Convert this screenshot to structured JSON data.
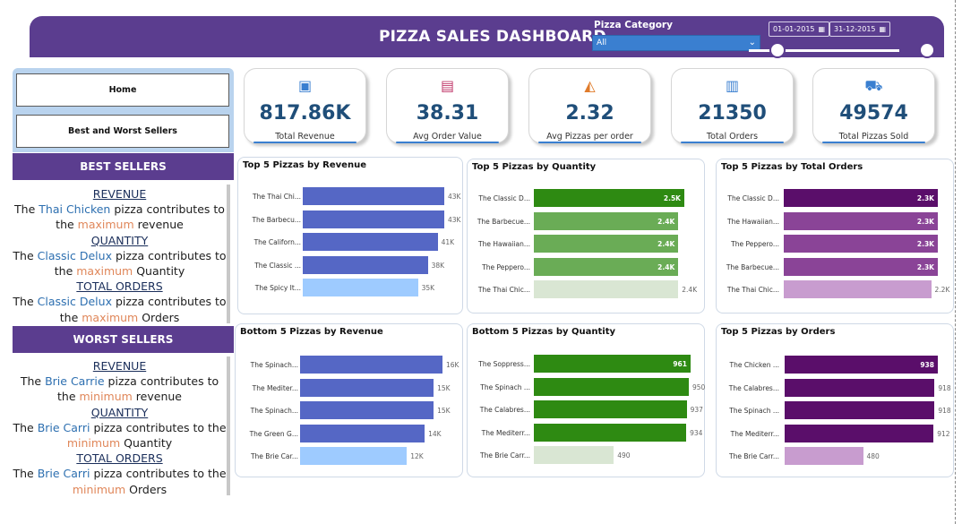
{
  "header": {
    "title": "PIZZA SALES DASHBOARD",
    "category_label": "Pizza Category",
    "category_value": "All",
    "date_start": "01-01-2015",
    "date_end": "31-12-2015"
  },
  "nav": {
    "home": "Home",
    "best_worst": "Best and Worst Sellers"
  },
  "best": {
    "title": "BEST SELLERS",
    "revenue_h": "REVENUE",
    "r_pre": "The ",
    "r_name": "Thai Chicken",
    "r_mid": " pizza contributes to the ",
    "r_word": "maximum",
    "r_post": " revenue",
    "quantity_h": "QUANTITY",
    "q_pre": "The ",
    "q_name": "Classic Delux",
    "q_mid": " pizza contributes to the ",
    "q_word": "maximum",
    "q_post": " Quantity",
    "orders_h": "TOTAL ORDERS",
    "o_pre": "The ",
    "o_name": "Classic Delux",
    "o_mid": " pizza contributes to the ",
    "o_word": "maximum",
    "o_post": " Orders"
  },
  "worst": {
    "title": "WORST SELLERS",
    "revenue_h": "REVENUE",
    "r_pre": "The ",
    "r_name": "Brie Carrie",
    "r_mid": " pizza contributes to the ",
    "r_word": "minimum",
    "r_post": " revenue",
    "quantity_h": "QUANTITY",
    "q_pre": "The ",
    "q_name": "Brie Carri",
    "q_mid": " pizza contributes to the ",
    "q_word": "minimum",
    "q_post": " Quantity",
    "orders_h": "TOTAL ORDERS",
    "o_pre": "The ",
    "o_name": "Brie Carri",
    "o_mid": " pizza contributes to the ",
    "o_word": "minimum",
    "o_post": " Orders"
  },
  "kpis": [
    {
      "value": "817.86K",
      "label": "Total Revenue",
      "icon": "money-icon"
    },
    {
      "value": "38.31",
      "label": "Avg Order Value",
      "icon": "register-icon"
    },
    {
      "value": "2.32",
      "label": "Avg Pizzas per order",
      "icon": "pizza-slice-icon"
    },
    {
      "value": "21350",
      "label": "Total Orders",
      "icon": "receipt-icon"
    },
    {
      "value": "49574",
      "label": "Total Pizzas Sold",
      "icon": "delivery-icon"
    }
  ],
  "colors": {
    "header": "#5b3d8f",
    "blue_bar": "#5567c5",
    "blue_light": "#9ecbff",
    "green_bar": "#2e8a12",
    "green_mid": "#6aac56",
    "green_light": "#d9e6d3",
    "purple_dark": "#5a0e6a",
    "purple_mid": "#8a4497",
    "purple_light": "#c89ccf"
  },
  "chart_data": [
    {
      "type": "bar",
      "title": "Top 5 Pizzas by Revenue",
      "categories": [
        "The Thai Chi...",
        "The Barbecu...",
        "The Californ...",
        "The Classic ...",
        "The Spicy It..."
      ],
      "values": [
        43,
        43,
        41,
        38,
        35
      ],
      "labels": [
        "43K",
        "43K",
        "41K",
        "38K",
        "35K"
      ],
      "xlim": [
        0,
        50
      ]
    },
    {
      "type": "bar",
      "title": "Top 5 Pizzas by Quantity",
      "categories": [
        "The Classic D...",
        "The Barbecue...",
        "The Hawaiian...",
        "The Peppero...",
        "The Thai Chic..."
      ],
      "values": [
        2.5,
        2.4,
        2.4,
        2.4,
        2.4
      ],
      "labels": [
        "2.5K",
        "2.4K",
        "2.4K",
        "2.4K",
        "2.4K"
      ],
      "xlim": [
        0,
        2.6
      ]
    },
    {
      "type": "bar",
      "title": "Top 5 Pizzas by Total Orders",
      "categories": [
        "The Classic D...",
        "The Hawaiian...",
        "The Peppero...",
        "The Barbecue...",
        "The Thai Chic..."
      ],
      "values": [
        2.3,
        2.3,
        2.3,
        2.3,
        2.2
      ],
      "labels": [
        "2.3K",
        "2.3K",
        "2.3K",
        "2.3K",
        "2.2K"
      ],
      "xlim": [
        0,
        2.4
      ]
    },
    {
      "type": "bar",
      "title": "Bottom 5 Pizzas by Revenue",
      "categories": [
        "The Spinach...",
        "The Mediter...",
        "The Spinach...",
        "The Green G...",
        "The Brie Car..."
      ],
      "values": [
        16,
        15,
        15,
        14,
        12
      ],
      "labels": [
        "16K",
        "15K",
        "15K",
        "14K",
        "12K"
      ],
      "xlim": [
        0,
        18
      ]
    },
    {
      "type": "bar",
      "title": "Bottom 5 Pizzas by Quantity",
      "categories": [
        "The Soppress...",
        "The Spinach ...",
        "The Calabres...",
        "The Mediterr...",
        "The Brie Carr..."
      ],
      "values": [
        961,
        950,
        937,
        934,
        490
      ],
      "labels": [
        "961",
        "950",
        "937",
        "934",
        "490"
      ],
      "xlim": [
        0,
        1000
      ]
    },
    {
      "type": "bar",
      "title": "Top 5 Pizzas by Orders",
      "categories": [
        "The Chicken ...",
        "The Calabres...",
        "The Spinach ...",
        "The Mediterr...",
        "The Brie Carr..."
      ],
      "values": [
        938,
        918,
        918,
        912,
        480
      ],
      "labels": [
        "938",
        "918",
        "918",
        "912",
        "480"
      ],
      "xlim": [
        0,
        1000
      ]
    }
  ]
}
